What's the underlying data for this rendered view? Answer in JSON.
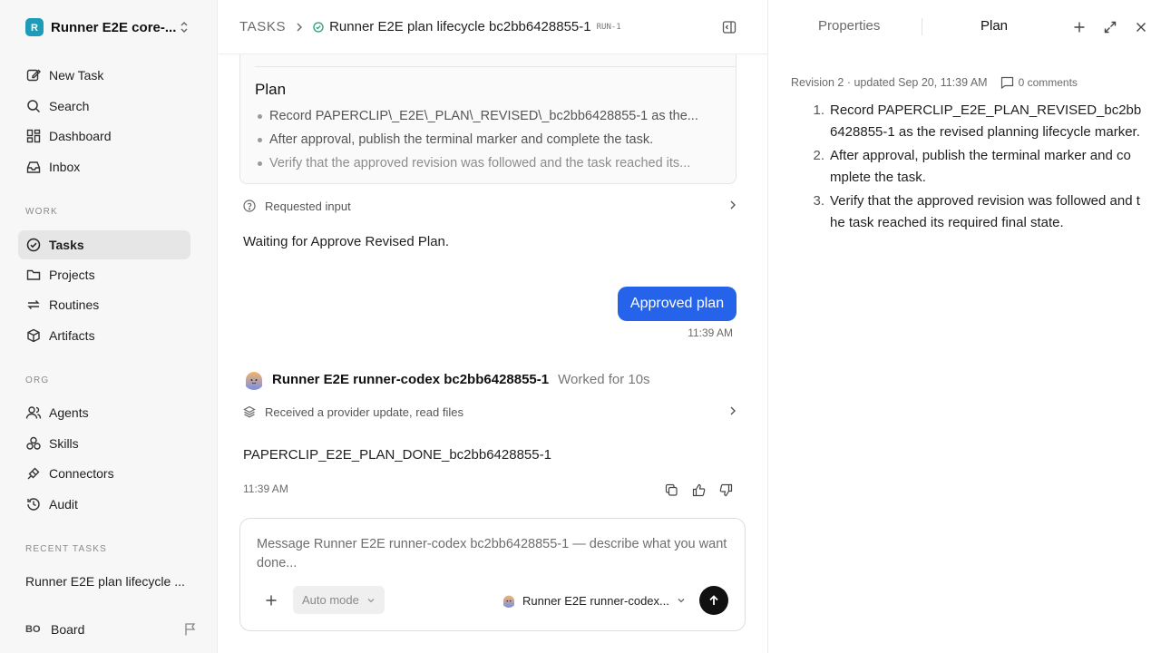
{
  "workspace": {
    "name": "Runner E2E core-...",
    "logo_letter": "R"
  },
  "nav": {
    "primary": [
      {
        "label": "New Task",
        "icon": "edit-icon"
      },
      {
        "label": "Search",
        "icon": "search-icon"
      },
      {
        "label": "Dashboard",
        "icon": "dashboard-icon"
      },
      {
        "label": "Inbox",
        "icon": "inbox-icon"
      }
    ],
    "work_label": "WORK",
    "work": [
      {
        "label": "Tasks",
        "icon": "check-circle-icon",
        "active": true
      },
      {
        "label": "Projects",
        "icon": "folder-icon"
      },
      {
        "label": "Routines",
        "icon": "repeat-icon"
      },
      {
        "label": "Artifacts",
        "icon": "box-icon"
      }
    ],
    "org_label": "ORG",
    "org": [
      {
        "label": "Agents",
        "icon": "users-icon"
      },
      {
        "label": "Skills",
        "icon": "skills-icon"
      },
      {
        "label": "Connectors",
        "icon": "plug-icon"
      },
      {
        "label": "Audit",
        "icon": "history-icon"
      }
    ],
    "recent_label": "RECENT TASKS",
    "recent": [
      "Runner E2E plan lifecycle ..."
    ],
    "board": {
      "initials": "BO",
      "name": "Board"
    }
  },
  "breadcrumb": {
    "root": "TASKS",
    "title": "Runner E2E plan lifecycle bc2bb6428855-1",
    "run_id": "RUN-1"
  },
  "thread": {
    "plan_card": {
      "title": "Plan",
      "items": [
        "Record PAPERCLIP\\_E2E\\_PLAN\\_REVISED\\_bc2bb6428855-1 as the...",
        "After approval, publish the terminal marker and complete the task.",
        "Verify that the approved revision was followed and the task reached its..."
      ]
    },
    "requested_input": "Requested input",
    "waiting": "Waiting for Approve Revised Plan.",
    "user_message": "Approved plan",
    "user_time": "11:39 AM",
    "agent": {
      "name": "Runner E2E runner-codex bc2bb6428855-1",
      "worked": "Worked for 10s"
    },
    "provider_update": "Received a provider update, read files",
    "agent_reply": "PAPERCLIP_E2E_PLAN_DONE_bc2bb6428855-1",
    "reply_time": "11:39 AM"
  },
  "composer": {
    "placeholder": "Message Runner E2E runner-codex bc2bb6428855-1 — describe what you want done...",
    "mode": "Auto mode",
    "agent": "Runner E2E runner-codex..."
  },
  "right_panel": {
    "tabs": {
      "properties": "Properties",
      "plan": "Plan"
    },
    "revision_meta": "Revision 2 · updated Sep 20, 11:39 AM",
    "comments": "0 comments",
    "steps": [
      {
        "num": "1.",
        "text": "Record PAPERCLIP_E2E_PLAN_REVISED_bc2bb6428855-1 as the revised planning lifecycle marker."
      },
      {
        "num": "2.",
        "text": "After approval, publish the terminal marker and complete the task."
      },
      {
        "num": "3.",
        "text": "Verify that the approved revision was followed and the task reached its required final state."
      }
    ]
  },
  "colors": {
    "accent": "#2563eb",
    "status_green": "#22a06b",
    "logo": "#1e9bb8"
  }
}
